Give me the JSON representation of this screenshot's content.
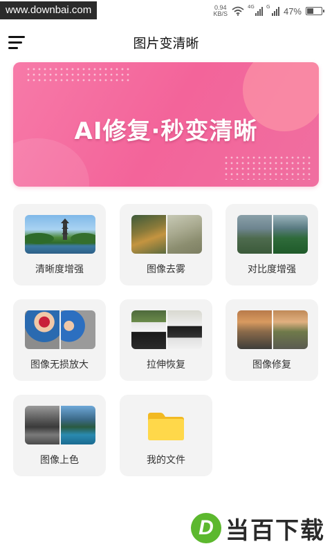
{
  "status_bar": {
    "watermark": "www.downbai.com",
    "net_speed_value": "0.94",
    "net_speed_unit": "KB/S",
    "signal1_label": "4G",
    "signal2_label": "G",
    "battery_text": "47%",
    "battery_level": 0.47
  },
  "app_bar": {
    "title": "图片变清晰",
    "menu_icon": "hamburger-menu-icon"
  },
  "banner": {
    "text": "AI修复·秒变清晰",
    "color_start": "#f77aa8",
    "color_end": "#f06fa0"
  },
  "features": [
    {
      "label": "清晰度增强",
      "icon": "pagoda-landscape-thumbnail"
    },
    {
      "label": "图像去雾",
      "icon": "forest-dehaze-thumbnail"
    },
    {
      "label": "对比度增强",
      "icon": "mountain-contrast-thumbnail"
    },
    {
      "label": "图像无损放大",
      "icon": "child-portrait-thumbnail"
    },
    {
      "label": "拉伸恢复",
      "icon": "panda-stretch-thumbnail"
    },
    {
      "label": "图像修复",
      "icon": "architecture-repair-thumbnail"
    },
    {
      "label": "图像上色",
      "icon": "lake-colorize-thumbnail"
    },
    {
      "label": "我的文件",
      "icon": "folder-icon"
    }
  ],
  "bottom_watermark": {
    "logo_letter": "D",
    "text": "当百下载",
    "logo_color": "#5cb82e"
  }
}
